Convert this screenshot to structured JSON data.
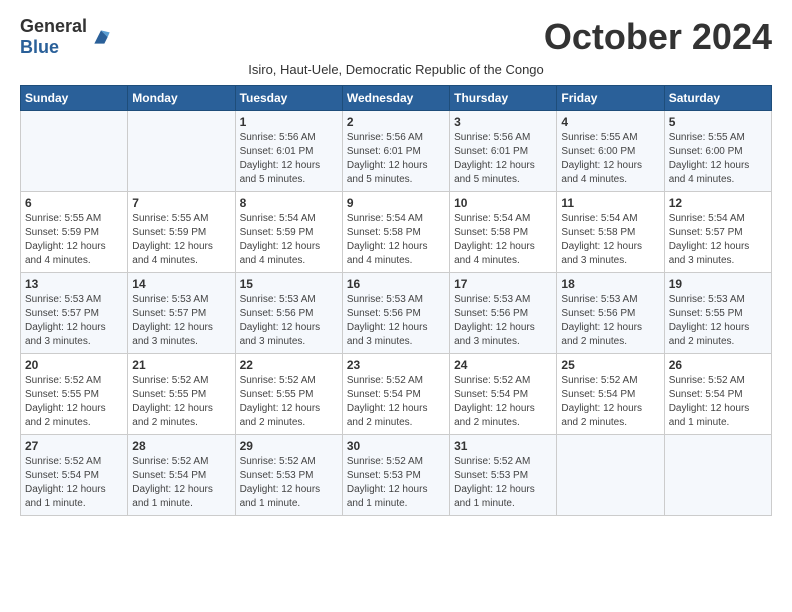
{
  "header": {
    "logo_general": "General",
    "logo_blue": "Blue",
    "month_title": "October 2024",
    "subtitle": "Isiro, Haut-Uele, Democratic Republic of the Congo"
  },
  "weekdays": [
    "Sunday",
    "Monday",
    "Tuesday",
    "Wednesday",
    "Thursday",
    "Friday",
    "Saturday"
  ],
  "weeks": [
    [
      {
        "day": "",
        "info": ""
      },
      {
        "day": "",
        "info": ""
      },
      {
        "day": "1",
        "info": "Sunrise: 5:56 AM\nSunset: 6:01 PM\nDaylight: 12 hours\nand 5 minutes."
      },
      {
        "day": "2",
        "info": "Sunrise: 5:56 AM\nSunset: 6:01 PM\nDaylight: 12 hours\nand 5 minutes."
      },
      {
        "day": "3",
        "info": "Sunrise: 5:56 AM\nSunset: 6:01 PM\nDaylight: 12 hours\nand 5 minutes."
      },
      {
        "day": "4",
        "info": "Sunrise: 5:55 AM\nSunset: 6:00 PM\nDaylight: 12 hours\nand 4 minutes."
      },
      {
        "day": "5",
        "info": "Sunrise: 5:55 AM\nSunset: 6:00 PM\nDaylight: 12 hours\nand 4 minutes."
      }
    ],
    [
      {
        "day": "6",
        "info": "Sunrise: 5:55 AM\nSunset: 5:59 PM\nDaylight: 12 hours\nand 4 minutes."
      },
      {
        "day": "7",
        "info": "Sunrise: 5:55 AM\nSunset: 5:59 PM\nDaylight: 12 hours\nand 4 minutes."
      },
      {
        "day": "8",
        "info": "Sunrise: 5:54 AM\nSunset: 5:59 PM\nDaylight: 12 hours\nand 4 minutes."
      },
      {
        "day": "9",
        "info": "Sunrise: 5:54 AM\nSunset: 5:58 PM\nDaylight: 12 hours\nand 4 minutes."
      },
      {
        "day": "10",
        "info": "Sunrise: 5:54 AM\nSunset: 5:58 PM\nDaylight: 12 hours\nand 4 minutes."
      },
      {
        "day": "11",
        "info": "Sunrise: 5:54 AM\nSunset: 5:58 PM\nDaylight: 12 hours\nand 3 minutes."
      },
      {
        "day": "12",
        "info": "Sunrise: 5:54 AM\nSunset: 5:57 PM\nDaylight: 12 hours\nand 3 minutes."
      }
    ],
    [
      {
        "day": "13",
        "info": "Sunrise: 5:53 AM\nSunset: 5:57 PM\nDaylight: 12 hours\nand 3 minutes."
      },
      {
        "day": "14",
        "info": "Sunrise: 5:53 AM\nSunset: 5:57 PM\nDaylight: 12 hours\nand 3 minutes."
      },
      {
        "day": "15",
        "info": "Sunrise: 5:53 AM\nSunset: 5:56 PM\nDaylight: 12 hours\nand 3 minutes."
      },
      {
        "day": "16",
        "info": "Sunrise: 5:53 AM\nSunset: 5:56 PM\nDaylight: 12 hours\nand 3 minutes."
      },
      {
        "day": "17",
        "info": "Sunrise: 5:53 AM\nSunset: 5:56 PM\nDaylight: 12 hours\nand 3 minutes."
      },
      {
        "day": "18",
        "info": "Sunrise: 5:53 AM\nSunset: 5:56 PM\nDaylight: 12 hours\nand 2 minutes."
      },
      {
        "day": "19",
        "info": "Sunrise: 5:53 AM\nSunset: 5:55 PM\nDaylight: 12 hours\nand 2 minutes."
      }
    ],
    [
      {
        "day": "20",
        "info": "Sunrise: 5:52 AM\nSunset: 5:55 PM\nDaylight: 12 hours\nand 2 minutes."
      },
      {
        "day": "21",
        "info": "Sunrise: 5:52 AM\nSunset: 5:55 PM\nDaylight: 12 hours\nand 2 minutes."
      },
      {
        "day": "22",
        "info": "Sunrise: 5:52 AM\nSunset: 5:55 PM\nDaylight: 12 hours\nand 2 minutes."
      },
      {
        "day": "23",
        "info": "Sunrise: 5:52 AM\nSunset: 5:54 PM\nDaylight: 12 hours\nand 2 minutes."
      },
      {
        "day": "24",
        "info": "Sunrise: 5:52 AM\nSunset: 5:54 PM\nDaylight: 12 hours\nand 2 minutes."
      },
      {
        "day": "25",
        "info": "Sunrise: 5:52 AM\nSunset: 5:54 PM\nDaylight: 12 hours\nand 2 minutes."
      },
      {
        "day": "26",
        "info": "Sunrise: 5:52 AM\nSunset: 5:54 PM\nDaylight: 12 hours\nand 1 minute."
      }
    ],
    [
      {
        "day": "27",
        "info": "Sunrise: 5:52 AM\nSunset: 5:54 PM\nDaylight: 12 hours\nand 1 minute."
      },
      {
        "day": "28",
        "info": "Sunrise: 5:52 AM\nSunset: 5:54 PM\nDaylight: 12 hours\nand 1 minute."
      },
      {
        "day": "29",
        "info": "Sunrise: 5:52 AM\nSunset: 5:53 PM\nDaylight: 12 hours\nand 1 minute."
      },
      {
        "day": "30",
        "info": "Sunrise: 5:52 AM\nSunset: 5:53 PM\nDaylight: 12 hours\nand 1 minute."
      },
      {
        "day": "31",
        "info": "Sunrise: 5:52 AM\nSunset: 5:53 PM\nDaylight: 12 hours\nand 1 minute."
      },
      {
        "day": "",
        "info": ""
      },
      {
        "day": "",
        "info": ""
      }
    ]
  ]
}
